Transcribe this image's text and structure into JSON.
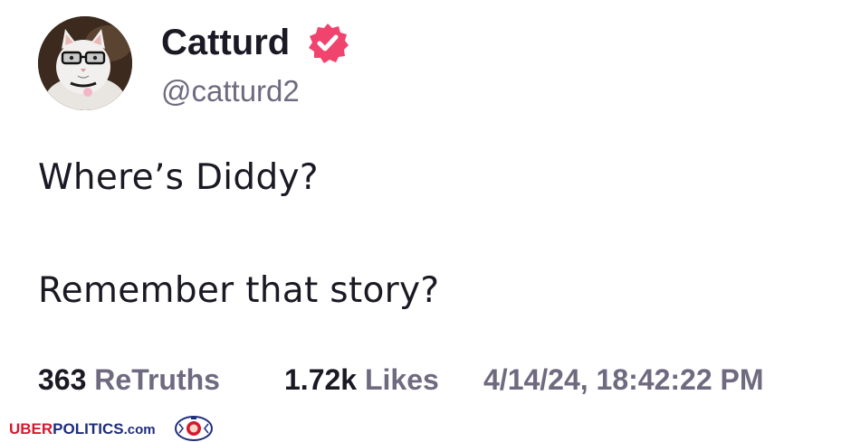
{
  "post": {
    "author": {
      "display_name": "Catturd",
      "handle": "@catturd2",
      "verified": true,
      "avatar_icon": "cat-with-glasses-avatar",
      "verified_icon": "verified-badge-icon",
      "verified_color": "#f0436d"
    },
    "body": {
      "line1": "Where’s Diddy?",
      "line2": "Remember that story?"
    },
    "stats": {
      "retruths_count": "363",
      "retruths_label": "ReTruths",
      "likes_count": "1.72k",
      "likes_label": "Likes",
      "timestamp": "4/14/24, 18:42:22 PM"
    }
  },
  "watermark": {
    "uber": "UBER",
    "politics": "POLITICS",
    "tld": ".com",
    "logo_icon": "lion-crest-logo",
    "colors": {
      "red": "#d7192f",
      "blue": "#1e2d7a"
    }
  }
}
